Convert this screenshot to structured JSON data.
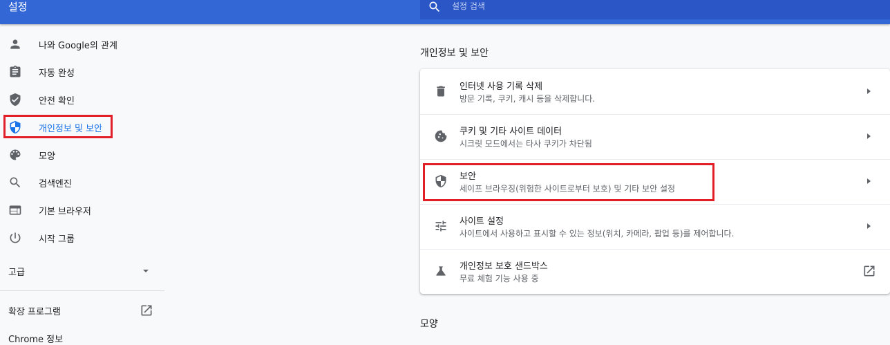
{
  "header": {
    "title": "설정",
    "search_placeholder": "설정 검색"
  },
  "sidebar": {
    "items": [
      {
        "label": "나와 Google의 관계",
        "icon": "person-icon"
      },
      {
        "label": "자동 완성",
        "icon": "clipboard-icon"
      },
      {
        "label": "안전 확인",
        "icon": "shield-check-icon"
      },
      {
        "label": "개인정보 및 보안",
        "icon": "shield-icon",
        "active": true
      },
      {
        "label": "모양",
        "icon": "palette-icon"
      },
      {
        "label": "검색엔진",
        "icon": "search-icon"
      },
      {
        "label": "기본 브라우저",
        "icon": "browser-icon"
      },
      {
        "label": "시작 그룹",
        "icon": "power-icon"
      }
    ],
    "advanced_label": "고급",
    "extensions_label": "확장 프로그램",
    "about_label": "Chrome 정보"
  },
  "main": {
    "section_title": "개인정보 및 보안",
    "rows": [
      {
        "title": "인터넷 사용 기록 삭제",
        "subtitle": "방문 기록, 쿠키, 캐시 등을 삭제합니다.",
        "icon": "trash-icon"
      },
      {
        "title": "쿠키 및 기타 사이트 데이터",
        "subtitle": "시크릿 모드에서는 타사 쿠키가 차단됨",
        "icon": "cookie-icon"
      },
      {
        "title": "보안",
        "subtitle": "세이프 브라우징(위험한 사이트로부터 보호) 및 기타 보안 설정",
        "icon": "shield-icon"
      },
      {
        "title": "사이트 설정",
        "subtitle": "사이트에서 사용하고 표시할 수 있는 정보(위치, 카메라, 팝업 등)를 제어합니다.",
        "icon": "tune-icon"
      },
      {
        "title": "개인정보 보호 샌드박스",
        "subtitle": "무료 체험 기능 사용 중",
        "icon": "flask-icon"
      }
    ],
    "next_section_title": "모양"
  },
  "colors": {
    "header_bg": "#3367d6",
    "accent": "#1a73e8",
    "highlight": "#e21f26"
  }
}
